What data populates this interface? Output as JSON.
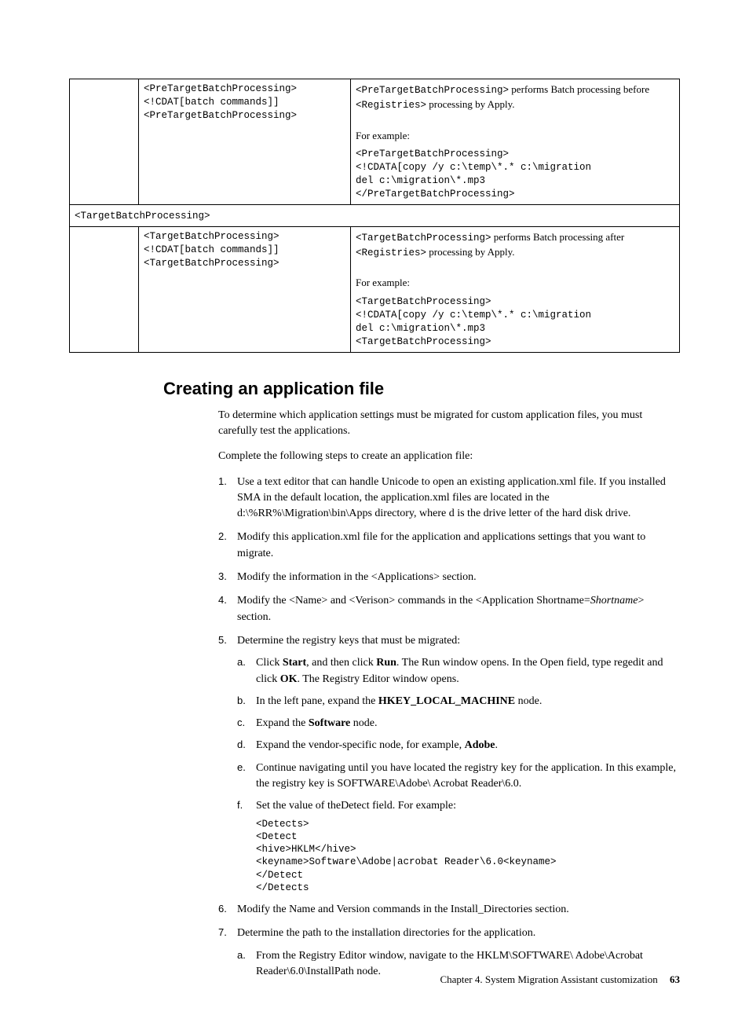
{
  "table": {
    "pre": {
      "syntax_l1": "<PreTargetBatchProcessing>",
      "syntax_l2": "<!CDAT[batch commands]]",
      "syntax_l3": "<PreTargetBatchProcessing>",
      "desc1a": "<PreTargetBatchProcessing>",
      "desc1b": " performs Batch processing before ",
      "desc2a": "<Registries>",
      "desc2b": " processing by Apply.",
      "exLabel": "For example:",
      "ex_l1": "<PreTargetBatchProcessing>",
      "ex_l2": "<!CDATA[copy /y c:\\temp\\*.* c:\\migration",
      "ex_l3": "del c:\\migration\\*.mp3",
      "ex_l4": "</PreTargetBatchProcessing>"
    },
    "sectionLabel": "<TargetBatchProcessing>",
    "tgt": {
      "syntax_l1": "<TargetBatchProcessing>",
      "syntax_l2": "<!CDAT[batch commands]]",
      "syntax_l3": "<TargetBatchProcessing>",
      "desc1a": "<TargetBatchProcessing>",
      "desc1b": " performs Batch processing after ",
      "desc2a": "<Registries>",
      "desc2b": " processing by Apply.",
      "exLabel": "For example:",
      "ex_l1": "<TargetBatchProcessing>",
      "ex_l2": "<!CDATA[copy /y c:\\temp\\*.* c:\\migration",
      "ex_l3": "del c:\\migration\\*.mp3",
      "ex_l4": "<TargetBatchProcessing>"
    }
  },
  "heading": "Creating an application file",
  "intro_p1": "To determine which application settings must be migrated for custom application files, you must carefully test the applications.",
  "intro_p2": "Complete the following steps to create an application file:",
  "steps": {
    "s1": "Use a text editor that can handle Unicode to open an existing application.xml file. If you installed SMA in the default location, the application.xml files are located in the d:\\%RR%\\Migration\\bin\\Apps directory, where d is the drive letter of the hard disk drive.",
    "s2": "Modify this application.xml file for the application and applications settings that you want to migrate.",
    "s3": "Modify the information in the <Applications> section.",
    "s4_a": "Modify the <Name> and <Verison> commands in the <Application Shortname=",
    "s4_b": "Shortname",
    "s4_c": "> section.",
    "s5": "Determine the registry keys that must be migrated:",
    "s5a_a": "Click ",
    "s5a_b": "Start",
    "s5a_c": ", and then click ",
    "s5a_d": "Run",
    "s5a_e": ". The Run window opens. In the Open field, type regedit and click ",
    "s5a_f": "OK",
    "s5a_g": ". The Registry Editor window opens.",
    "s5b_a": "In the left pane, expand the ",
    "s5b_b": "HKEY_LOCAL_MACHINE",
    "s5b_c": " node.",
    "s5c_a": "Expand the ",
    "s5c_b": "Software",
    "s5c_c": " node.",
    "s5d_a": "Expand the vendor-specific node, for example, ",
    "s5d_b": "Adobe",
    "s5d_c": ".",
    "s5e": "Continue navigating until you have located the registry key for the application. In this example, the registry key is SOFTWARE\\Adobe\\ Acrobat Reader\\6.0.",
    "s5f": "Set the value of theDetect field. For example:",
    "s5f_code": "<Detects>\n<Detect\n<hive>HKLM</hive>\n<keyname>Software\\Adobe|acrobat Reader\\6.0<keyname>\n</Detect\n</Detects",
    "s6": "Modify the Name and Version commands in the Install_Directories section.",
    "s7": "Determine the path to the installation directories for the application.",
    "s7a": "From the Registry Editor window, navigate to the HKLM\\SOFTWARE\\ Adobe\\Acrobat Reader\\6.0\\InstallPath node."
  },
  "footer": {
    "chapter": "Chapter 4. System Migration Assistant customization",
    "page": "63"
  }
}
